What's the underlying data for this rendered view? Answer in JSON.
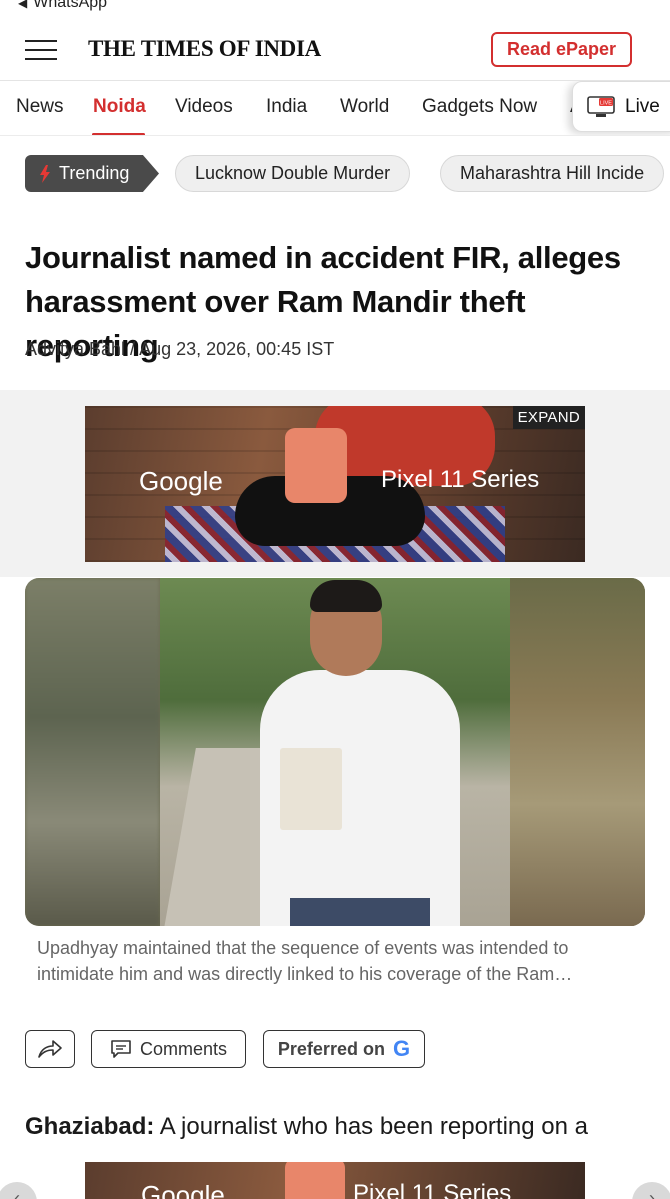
{
  "status": {
    "back_app": "WhatsApp"
  },
  "header": {
    "logo": "THE TIMES OF INDIA",
    "epaper_label": "Read ePaper"
  },
  "nav": {
    "items": [
      {
        "label": "News"
      },
      {
        "label": "Noida",
        "active": true
      },
      {
        "label": "Videos"
      },
      {
        "label": "India"
      },
      {
        "label": "World"
      },
      {
        "label": "Gadgets Now"
      },
      {
        "label": "A"
      }
    ],
    "live_label": "Live",
    "live_badge": "LIVE"
  },
  "trending": {
    "tag_label": "Trending",
    "pills": [
      "Lucknow Double Murder",
      "Maharashtra Hill Incide"
    ]
  },
  "article": {
    "headline": "Journalist named in accident FIR, alleges harassment over Ram Mandir theft reporting",
    "byline": "Advitya Bahl / Aug 23, 2026, 00:45 IST",
    "caption": "Upadhyay maintained that the sequence of events was intended to intimidate him and was directly linked to his coverage of the Ram…",
    "dateline": "Ghaziabad:",
    "lead": "A journalist who has been reporting on a"
  },
  "ad": {
    "brand": "Google",
    "product": "Pixel 11 Series",
    "expand_label": "EXPAND"
  },
  "actions": {
    "comments_label": "Comments",
    "preferred_label": "Preferred on",
    "preferred_logo": "G"
  },
  "colors": {
    "accent": "#d32f2f",
    "trending_bg": "#4a4a4a"
  }
}
